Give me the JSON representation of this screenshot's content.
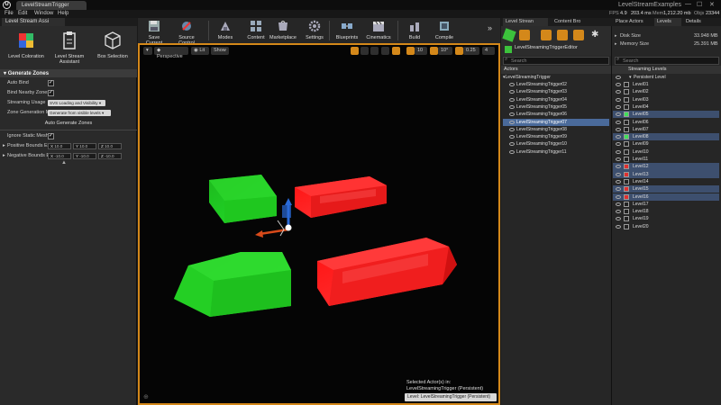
{
  "titlebar": {
    "tab": "LevelStreamTrigger",
    "project": "LevelStreamExamples",
    "min": "—",
    "max": "☐",
    "close": "✕"
  },
  "menu": [
    "File",
    "Edit",
    "Window",
    "Help"
  ],
  "stats": {
    "fps_label": "FPS",
    "fps": "4.9",
    "ms": "203.4 ms",
    "mem_label": "Mem",
    "mem": "1,212.20 mb",
    "objs_label": "Objs",
    "objs": "23344"
  },
  "left": {
    "tab": "Level Stream Assi",
    "tools": [
      "Level Coloration",
      "Level Stream Assistant",
      "Box Selection"
    ],
    "section": "Generate Zones",
    "auto_bind": "Auto Bind",
    "bind_nearby": "Bind Nearby Zones",
    "streaming_usage": "Streaming Usage",
    "streaming_usage_value": "SVS Loading and Visibility ▾",
    "zone_gen": "Zone Generation Mo",
    "zone_gen_value": "Generate from visible levels ▾",
    "auto_generate": "Auto Generate Zones",
    "ignore_static": "Ignore Static Mesh E",
    "pos_bounds": "Positive Bounds Ext",
    "neg_bounds": "Negative Bounds Ex",
    "pos_vals": [
      [
        "X",
        "10.0"
      ],
      [
        "Y",
        "10.0"
      ],
      [
        "Z",
        "10.0"
      ]
    ],
    "neg_vals": [
      [
        "X",
        "-10.0"
      ],
      [
        "Y",
        "-10.0"
      ],
      [
        "Z",
        "-10.0"
      ]
    ],
    "collapse": "▲"
  },
  "toolbar": [
    "Save Current",
    "Source Control",
    "Modes",
    "Content",
    "Marketplace",
    "Settings",
    "Blueprints",
    "Cinematics",
    "Build",
    "Compile"
  ],
  "viewport": {
    "perspective": "Perspective",
    "lit": "Lit",
    "show": "Show",
    "snap_angle": "10°",
    "snap_scale": "0.25",
    "cam_speed": "4",
    "selected_title": "Selected Actor(s) in:",
    "selected_name": "LevelStreamingTrigger (Persistent)",
    "level_label": "Level:  LevelStreamingTrigger (Persistent)"
  },
  "right": {
    "top_tabs": [
      "Level Strean",
      "Content Bro",
      "Place Actors",
      "Levels",
      "Details"
    ],
    "actor_name": "LevelStreamingTriggerEditor",
    "disk_label": "Disk Size",
    "disk": "33.948 MB",
    "memory_label": "Memory Size",
    "memory": "25.391 MB",
    "search": "Search",
    "actors_header": "Actors",
    "actors_root": "LevelStreamingTrigger",
    "actors": [
      "LevelStreamingTrigger02",
      "LevelStreamingTrigger03",
      "LevelStreamingTrigger04",
      "LevelStreamingTrigger05",
      "LevelStreamingTrigger06",
      "LevelStreamingTrigger07",
      "LevelStreamingTrigger08",
      "LevelStreamingTrigger09",
      "LevelStreamingTrigger10",
      "LevelStreamingTrigger11"
    ],
    "selected_actor": "LevelStreamingTrigger07",
    "levels_header": "Streaming Levels",
    "persistent": "Persistent Level",
    "levels": [
      "Level01",
      "Level02",
      "Level03",
      "Level04",
      "Level05",
      "Level06",
      "Level07",
      "Level08",
      "Level09",
      "Level10",
      "Level11",
      "Level12",
      "Level13",
      "Level14",
      "Level15",
      "Level16",
      "Level17",
      "Level18",
      "Level19",
      "Level20"
    ],
    "level_colors": [
      "#222",
      "#222",
      "#222",
      "#222",
      "#3fe05a",
      "#222",
      "#222",
      "#3fe05a",
      "#222",
      "#222",
      "#222",
      "#e03030",
      "#e03030",
      "#222",
      "#e03030",
      "#e03030",
      "#222",
      "#222",
      "#222",
      "#222"
    ],
    "level_highlight": [
      false,
      false,
      false,
      false,
      true,
      false,
      false,
      true,
      false,
      false,
      false,
      true,
      true,
      false,
      true,
      true,
      false,
      false,
      false,
      false
    ]
  }
}
